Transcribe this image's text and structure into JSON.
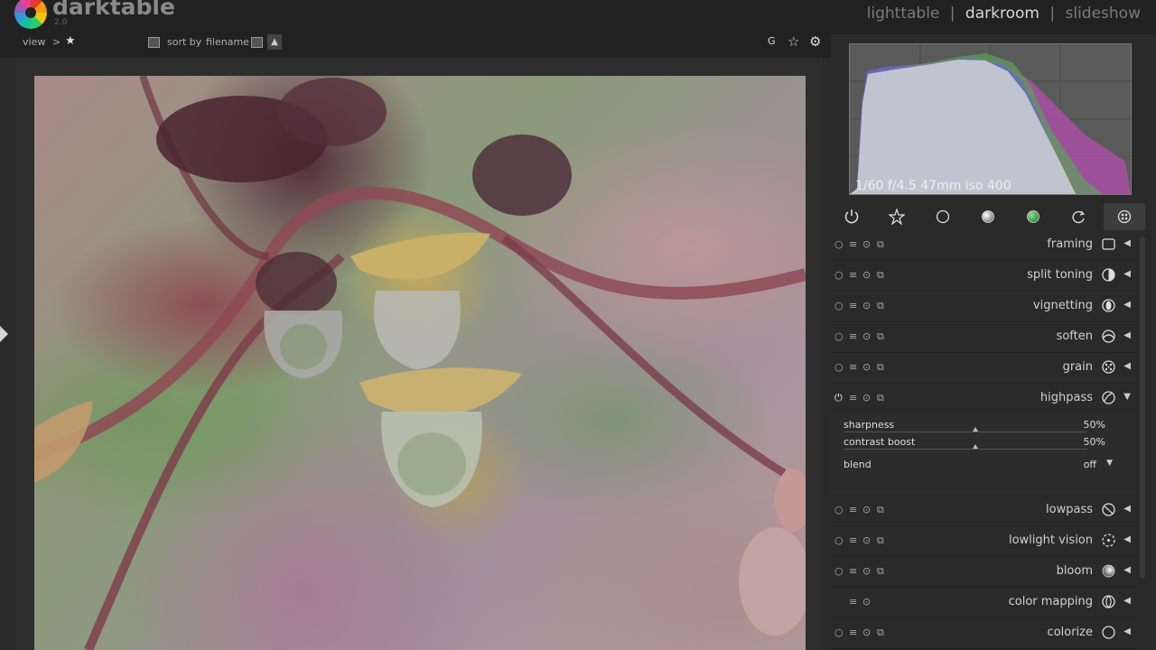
{
  "app": {
    "name": "darktable",
    "version": "2.0",
    "views": [
      "lighttable",
      "darkroom",
      "slideshow"
    ],
    "separator": "|",
    "active_view": "darkroom"
  },
  "toolbar": {
    "view_label": "view",
    "view_sep": ">",
    "star_icon": "star-icon",
    "sort_by_label": "sort by",
    "sort_value": "filename",
    "grouping_label": "G"
  },
  "histogram": {
    "exif": "1/60 f/4.5 47mm iso 400"
  },
  "tabs": [
    {
      "icon": "power-icon"
    },
    {
      "icon": "star-burst-icon"
    },
    {
      "icon": "circle-icon"
    },
    {
      "icon": "gray-circle-icon"
    },
    {
      "icon": "color-circle-icon"
    },
    {
      "icon": "correct-icon"
    },
    {
      "icon": "effect-icon",
      "selected": true
    }
  ],
  "modules": [
    {
      "name": "framing",
      "icon": "framing-icon"
    },
    {
      "name": "split toning",
      "icon": "split-toning-icon"
    },
    {
      "name": "vignetting",
      "icon": "vignetting-icon"
    },
    {
      "name": "soften",
      "icon": "soften-icon"
    },
    {
      "name": "grain",
      "icon": "grain-icon"
    },
    {
      "name": "highpass",
      "icon": "highpass-icon",
      "expanded": true
    }
  ],
  "modules_after": [
    {
      "name": "lowpass",
      "icon": "lowpass-icon"
    },
    {
      "name": "lowlight vision",
      "icon": "lowlight-icon"
    },
    {
      "name": "bloom",
      "icon": "bloom-icon"
    },
    {
      "name": "color mapping",
      "icon": "color-mapping-icon"
    },
    {
      "name": "colorize",
      "icon": "colorize-icon"
    }
  ],
  "highpass": {
    "sharpness_label": "sharpness",
    "sharpness_value": "50%",
    "contrast_label": "contrast boost",
    "contrast_value": "50%",
    "blend_label": "blend",
    "blend_value": "off"
  }
}
